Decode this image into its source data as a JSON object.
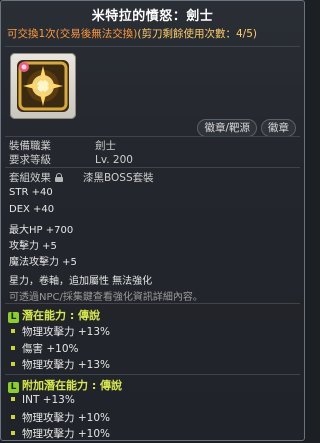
{
  "title": "米特拉的憤怒：劍士",
  "trade_notice": {
    "main": "可交換1次(交易後無法交換)",
    "scissors": "(剪刀剩餘使用次數：4/5)"
  },
  "icon": "emblem-item-icon",
  "buttons": [
    {
      "label": "徽章/靶源"
    },
    {
      "label": "徽章"
    }
  ],
  "info": {
    "job_label": "裝備職業",
    "job_value": "劍士",
    "level_label": "要求等級",
    "level_value": "Lv. 200",
    "set_label": "套組效果",
    "set_value": "漆黑BOSS套裝"
  },
  "stats": [
    "STR  +40",
    "DEX  +40",
    "最大HP  +700",
    "攻擊力  +5",
    "魔法攻擊力  +5"
  ],
  "attrs": "星力，卷軸，追加屬性 無法強化",
  "npc_note": "可透過NPC/採集鍵查看強化資訊詳細內容。",
  "potential": {
    "header": "潛在能力 : 傳說",
    "badge": "L",
    "lines": [
      "物理攻擊力 +13%",
      "傷害 +10%",
      "物理攻擊力 +13%"
    ]
  },
  "additional_potential": {
    "header": "附加潛在能力 : 傳說",
    "badge": "L",
    "lines": [
      "INT +13%",
      "物理攻擊力 +10%",
      "物理攻擊力 +10%"
    ]
  },
  "colors": {
    "title": "#ffffff",
    "trade": "#ff9a3c",
    "legend": "#d6e84a",
    "badge": "#8ccf2b"
  }
}
